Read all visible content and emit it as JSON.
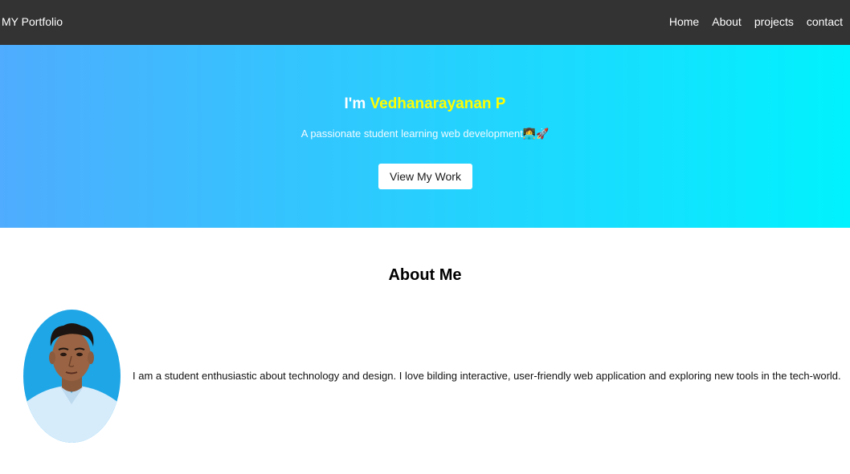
{
  "nav": {
    "brand": "MY Portfolio",
    "links": [
      "Home",
      "About",
      "projects",
      "contact"
    ]
  },
  "hero": {
    "greeting": "I'm ",
    "name": "Vedhanarayanan P",
    "subtitle": "A passionate student learning web development👩‍💻🚀",
    "button_label": "View My Work",
    "gradient_start": "#4facfe",
    "gradient_end": "#00f2fe",
    "name_color": "#ffff00"
  },
  "about": {
    "title": "About Me",
    "text": "I am a student enthusiastic about technology and design. I love bilding interactive, user-friendly web application and exploring new tools in the tech-world.",
    "photo_icon": "profile-photo"
  },
  "colors": {
    "navbar_bg": "#333333",
    "button_bg": "#ffffff"
  }
}
